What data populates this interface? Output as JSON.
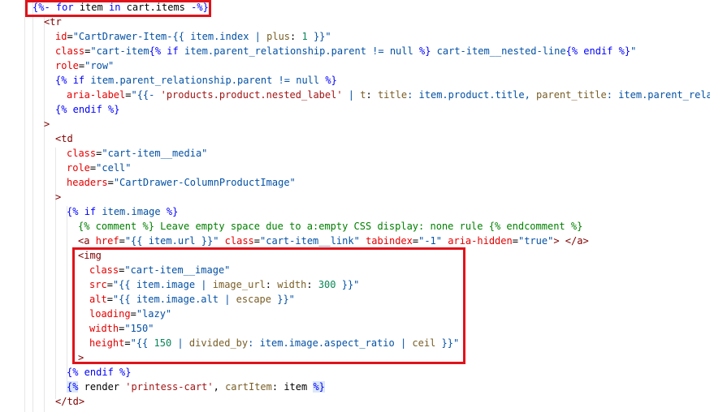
{
  "code": {
    "lines": [
      {
        "indent": 40,
        "tokens": [
          {
            "t": "{%-",
            "c": "kw"
          },
          {
            "t": " ",
            "c": "pun"
          },
          {
            "t": "for",
            "c": "kw"
          },
          {
            "t": " item ",
            "c": "pun"
          },
          {
            "t": "in",
            "c": "kw"
          },
          {
            "t": " cart.items ",
            "c": "pun"
          },
          {
            "t": "-%}",
            "c": "kw"
          }
        ]
      },
      {
        "indent": 54,
        "tokens": [
          {
            "t": "<tr",
            "c": "tag"
          }
        ]
      },
      {
        "indent": 68,
        "tokens": [
          {
            "t": "id",
            "c": "attr"
          },
          {
            "t": "=",
            "c": "pun"
          },
          {
            "t": "\"CartDrawer-Item-{{ ",
            "c": "val"
          },
          {
            "t": "item.index",
            "c": "val"
          },
          {
            "t": " | ",
            "c": "val"
          },
          {
            "t": "plus",
            "c": "fn"
          },
          {
            "t": ": ",
            "c": "pun"
          },
          {
            "t": "1",
            "c": "num"
          },
          {
            "t": " }}\"",
            "c": "val"
          }
        ]
      },
      {
        "indent": 68,
        "tokens": [
          {
            "t": "class",
            "c": "attr"
          },
          {
            "t": "=",
            "c": "pun"
          },
          {
            "t": "\"cart-item",
            "c": "val"
          },
          {
            "t": "{% ",
            "c": "kw"
          },
          {
            "t": "if",
            "c": "kw"
          },
          {
            "t": " item.parent_relationship.parent != null ",
            "c": "val"
          },
          {
            "t": "%}",
            "c": "kw"
          },
          {
            "t": " cart-item__nested-line",
            "c": "val"
          },
          {
            "t": "{% endif %}",
            "c": "kw"
          },
          {
            "t": "\"",
            "c": "val"
          }
        ]
      },
      {
        "indent": 68,
        "tokens": [
          {
            "t": "role",
            "c": "attr"
          },
          {
            "t": "=",
            "c": "pun"
          },
          {
            "t": "\"row\"",
            "c": "val"
          }
        ]
      },
      {
        "indent": 68,
        "tokens": [
          {
            "t": "{% ",
            "c": "kw"
          },
          {
            "t": "if",
            "c": "kw"
          },
          {
            "t": " item.parent_relationship.parent != null ",
            "c": "val"
          },
          {
            "t": "%}",
            "c": "kw"
          }
        ]
      },
      {
        "indent": 82,
        "tokens": [
          {
            "t": "aria-label",
            "c": "attr"
          },
          {
            "t": "=",
            "c": "pun"
          },
          {
            "t": "\"{{- ",
            "c": "val"
          },
          {
            "t": "'products.product.nested_label'",
            "c": "str"
          },
          {
            "t": " | ",
            "c": "val"
          },
          {
            "t": "t",
            "c": "fn"
          },
          {
            "t": ": ",
            "c": "pun"
          },
          {
            "t": "title",
            "c": "fn"
          },
          {
            "t": ": item.product.title, ",
            "c": "val"
          },
          {
            "t": "parent_title",
            "c": "fn"
          },
          {
            "t": ": item.parent_rela",
            "c": "val"
          }
        ]
      },
      {
        "indent": 68,
        "tokens": [
          {
            "t": "{% endif %}",
            "c": "kw"
          }
        ]
      },
      {
        "indent": 54,
        "tokens": [
          {
            "t": ">",
            "c": "tag"
          }
        ]
      },
      {
        "indent": 68,
        "tokens": [
          {
            "t": "<td",
            "c": "tag"
          }
        ]
      },
      {
        "indent": 82,
        "tokens": [
          {
            "t": "class",
            "c": "attr"
          },
          {
            "t": "=",
            "c": "pun"
          },
          {
            "t": "\"cart-item__media\"",
            "c": "val"
          }
        ]
      },
      {
        "indent": 82,
        "tokens": [
          {
            "t": "role",
            "c": "attr"
          },
          {
            "t": "=",
            "c": "pun"
          },
          {
            "t": "\"cell\"",
            "c": "val"
          }
        ]
      },
      {
        "indent": 82,
        "tokens": [
          {
            "t": "headers",
            "c": "attr"
          },
          {
            "t": "=",
            "c": "pun"
          },
          {
            "t": "\"CartDrawer-ColumnProductImage\"",
            "c": "val"
          }
        ]
      },
      {
        "indent": 68,
        "tokens": [
          {
            "t": ">",
            "c": "tag"
          }
        ]
      },
      {
        "indent": 82,
        "tokens": [
          {
            "t": "{% ",
            "c": "kw"
          },
          {
            "t": "if",
            "c": "kw"
          },
          {
            "t": " item.image ",
            "c": "val"
          },
          {
            "t": "%}",
            "c": "kw"
          }
        ]
      },
      {
        "indent": 96,
        "tokens": [
          {
            "t": "{% comment %}",
            "c": "cmt"
          },
          {
            "t": " Leave empty space due to a:empty CSS display: none rule ",
            "c": "cmt"
          },
          {
            "t": "{% endcomment %}",
            "c": "cmt"
          }
        ]
      },
      {
        "indent": 96,
        "tokens": [
          {
            "t": "<a",
            "c": "tag"
          },
          {
            "t": " ",
            "c": "pun"
          },
          {
            "t": "href",
            "c": "attr"
          },
          {
            "t": "=",
            "c": "pun"
          },
          {
            "t": "\"{{ item.url }}\"",
            "c": "val"
          },
          {
            "t": " ",
            "c": "pun"
          },
          {
            "t": "class",
            "c": "attr"
          },
          {
            "t": "=",
            "c": "pun"
          },
          {
            "t": "\"cart-item__link\"",
            "c": "val"
          },
          {
            "t": " ",
            "c": "pun"
          },
          {
            "t": "tabindex",
            "c": "attr"
          },
          {
            "t": "=",
            "c": "pun"
          },
          {
            "t": "\"-1\"",
            "c": "val"
          },
          {
            "t": " ",
            "c": "pun"
          },
          {
            "t": "aria-hidden",
            "c": "attr"
          },
          {
            "t": "=",
            "c": "pun"
          },
          {
            "t": "\"true\"",
            "c": "val"
          },
          {
            "t": "> </a>",
            "c": "tag"
          }
        ]
      },
      {
        "indent": 96,
        "tokens": [
          {
            "t": "<img",
            "c": "tag"
          }
        ]
      },
      {
        "indent": 110,
        "tokens": [
          {
            "t": "class",
            "c": "attr"
          },
          {
            "t": "=",
            "c": "pun"
          },
          {
            "t": "\"cart-item__image\"",
            "c": "val"
          }
        ]
      },
      {
        "indent": 110,
        "tokens": [
          {
            "t": "src",
            "c": "attr"
          },
          {
            "t": "=",
            "c": "pun"
          },
          {
            "t": "\"{{ item.image | ",
            "c": "val"
          },
          {
            "t": "image_url",
            "c": "fn"
          },
          {
            "t": ": ",
            "c": "pun"
          },
          {
            "t": "width",
            "c": "fn"
          },
          {
            "t": ": ",
            "c": "pun"
          },
          {
            "t": "300",
            "c": "num"
          },
          {
            "t": " }}\"",
            "c": "val"
          }
        ]
      },
      {
        "indent": 110,
        "tokens": [
          {
            "t": "alt",
            "c": "attr"
          },
          {
            "t": "=",
            "c": "pun"
          },
          {
            "t": "\"{{ item.image.alt | ",
            "c": "val"
          },
          {
            "t": "escape",
            "c": "fn"
          },
          {
            "t": " }}\"",
            "c": "val"
          }
        ]
      },
      {
        "indent": 110,
        "tokens": [
          {
            "t": "loading",
            "c": "attr"
          },
          {
            "t": "=",
            "c": "pun"
          },
          {
            "t": "\"lazy\"",
            "c": "val"
          }
        ]
      },
      {
        "indent": 110,
        "tokens": [
          {
            "t": "width",
            "c": "attr"
          },
          {
            "t": "=",
            "c": "pun"
          },
          {
            "t": "\"150\"",
            "c": "val"
          }
        ]
      },
      {
        "indent": 110,
        "tokens": [
          {
            "t": "height",
            "c": "attr"
          },
          {
            "t": "=",
            "c": "pun"
          },
          {
            "t": "\"{{ ",
            "c": "val"
          },
          {
            "t": "150",
            "c": "num"
          },
          {
            "t": " | ",
            "c": "val"
          },
          {
            "t": "divided_by",
            "c": "fn"
          },
          {
            "t": ": item.image.aspect_ratio | ",
            "c": "val"
          },
          {
            "t": "ceil",
            "c": "fn"
          },
          {
            "t": " }}\"",
            "c": "val"
          }
        ]
      },
      {
        "indent": 96,
        "tokens": [
          {
            "t": ">",
            "c": "tag"
          }
        ]
      },
      {
        "indent": 82,
        "tokens": [
          {
            "t": "{% endif %}",
            "c": "kw"
          }
        ]
      },
      {
        "indent": 82,
        "tokens": [
          {
            "t": "{%",
            "c": "kw",
            "hl": true
          },
          {
            "t": " render ",
            "c": "pun"
          },
          {
            "t": "'printess-cart'",
            "c": "str"
          },
          {
            "t": ", ",
            "c": "pun"
          },
          {
            "t": "cartItem",
            "c": "fn"
          },
          {
            "t": ": item ",
            "c": "pun"
          },
          {
            "t": "%}",
            "c": "kw",
            "hl": true
          }
        ]
      },
      {
        "indent": 68,
        "tokens": [
          {
            "t": "</td>",
            "c": "tag"
          }
        ]
      }
    ]
  },
  "colors": {
    "highlight_box": "#e0131a"
  }
}
